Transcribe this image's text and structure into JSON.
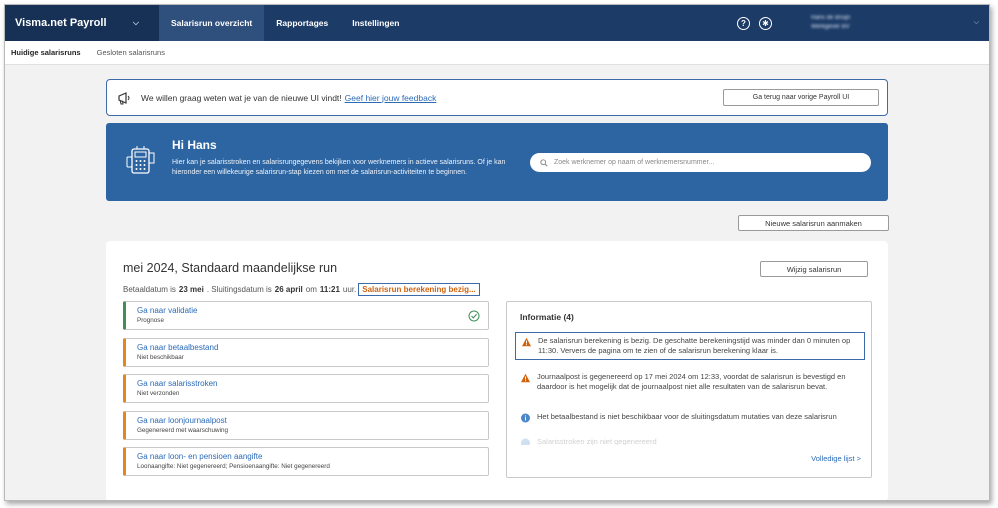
{
  "nav": {
    "brand": "Visma.net Payroll",
    "tabs": [
      "Salarisrun overzicht",
      "Rapportages",
      "Instellingen"
    ],
    "user_line1": "Hans de Bruijn",
    "user_line2": "Werkgever BV",
    "help_glyph": "?",
    "accessibility_glyph": "✱"
  },
  "subnav": [
    "Huidige salarisruns",
    "Gesloten salarisruns"
  ],
  "feedback": {
    "text": "We willen graag weten wat je van de nieuwe UI vindt!",
    "link": "Geef hier jouw feedback",
    "back_button": "Ga terug naar vorige Payroll UI"
  },
  "hero": {
    "greeting": "Hi Hans",
    "text": "Hier kan je salarisstroken en salarisrungegevens bekijken voor werknemers in actieve salarisruns. Of je kan hieronder een willekeurige salarisrun-stap kiezen om met de salarisrun-activiteiten te beginnen.",
    "search_placeholder": "Zoek werknemer op naam of werknemersnummer..."
  },
  "new_run_button": "Nieuwe salarisrun aanmaken",
  "run": {
    "title": "mei 2024, Standaard maandelijkse run",
    "pay_label": "Betaaldatum is",
    "pay_date": "23 mei",
    "close_label": ". Sluitingsdatum is",
    "close_date": "26 april",
    "time_label": "om",
    "close_time": "11:21",
    "uur": "uur.",
    "status": "Salarisrun berekening bezig...",
    "edit_button": "Wijzig salarisrun"
  },
  "steps": [
    {
      "title": "Ga naar validatie",
      "sub": "Prognose",
      "done": true
    },
    {
      "title": "Ga naar betaalbestand",
      "sub": "Niet beschikbaar",
      "done": false
    },
    {
      "title": "Ga naar salarisstroken",
      "sub": "Niet verzonden",
      "done": false
    },
    {
      "title": "Ga naar loonjournaalpost",
      "sub": "Gegenereerd met waarschuwing",
      "done": false
    },
    {
      "title": "Ga naar loon- en pensioen aangifte",
      "sub": "Loonaangifte: Niet gegenereerd; Pensioenaangifte: Niet gegenereerd",
      "done": false
    }
  ],
  "info": {
    "title": "Informatie (4)",
    "items": [
      {
        "icon": "warning-icon",
        "text": "De salarisrun berekening is bezig. De geschatte berekeningstijd was minder dan 0 minuten op 11:30. Ververs de pagina om te zien of de salarisrun berekening klaar is."
      },
      {
        "icon": "warning-icon",
        "text": "Journaalpost is gegenereerd op 17 mei 2024 om 12:33, voordat de salarisrun is bevestigd en daardoor is het mogelijk dat de journaalpost niet alle resultaten van de salarisrun bevat."
      },
      {
        "icon": "info-icon",
        "text": "Het betaalbestand is niet beschikbaar voor de sluitingsdatum mutaties van deze salarisrun"
      },
      {
        "icon": "info-icon",
        "text": "Salarisstroken zijn niet gegenereerd"
      }
    ],
    "more_link": "Volledige lijst >"
  },
  "colors": {
    "nav_bg": "#1c3b67",
    "hero_bg": "#2d65a2",
    "warning": "#e3861f",
    "success": "#3f8f5a",
    "link": "#2a6bb8"
  }
}
